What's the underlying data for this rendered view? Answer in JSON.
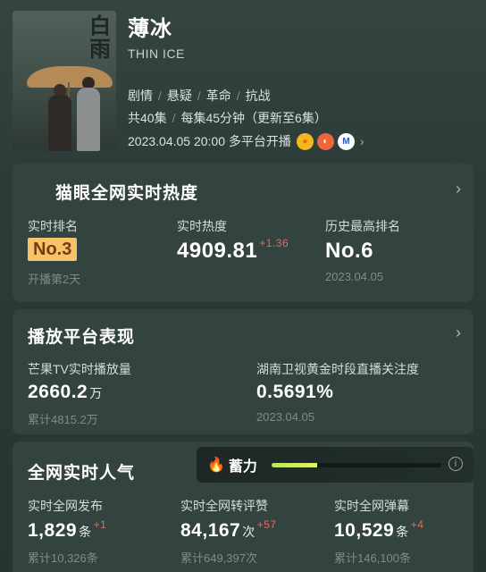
{
  "show": {
    "title": "薄冰",
    "subtitle": "THIN ICE",
    "poster_glyph": "白\n雨",
    "tags": [
      "剧情",
      "悬疑",
      "革命",
      "抗战"
    ],
    "episodes": "共40集",
    "duration": "每集45分钟（更新至6集）",
    "airing": "2023.04.05 20:00 多平台开播",
    "platform_icons": [
      "mango-tv-icon",
      "hunan-tv-icon",
      "m-platform-icon"
    ],
    "platform_glyphs": [
      "●",
      "◐",
      "M"
    ]
  },
  "heat": {
    "title": "猫眼全网实时热度",
    "rank_label": "实时排名",
    "rank_value": "No.3",
    "rank_sub": "开播第2天",
    "heat_label": "实时热度",
    "heat_value": "4909.81",
    "heat_delta": "+1.36",
    "best_label": "历史最高排名",
    "best_value": "No.6",
    "best_date": "2023.04.05"
  },
  "platform": {
    "title": "播放平台表现",
    "mango_label": "芒果TV实时播放量",
    "mango_value": "2660.2",
    "mango_unit": "万",
    "mango_total": "累计4815.2万",
    "hunan_label": "湖南卫视黄金时段直播关注度",
    "hunan_value": "0.5691%",
    "hunan_date": "2023.04.05"
  },
  "popularity": {
    "title": "全网实时人气",
    "post_label": "实时全网发布",
    "post_value": "1,829",
    "post_unit": "条",
    "post_delta": "+1",
    "post_total": "累计10,326条",
    "repost_label": "实时全网转评赞",
    "repost_value": "84,167",
    "repost_unit": "次",
    "repost_delta": "+57",
    "repost_total": "累计649,397次",
    "danmu_label": "实时全网弹幕",
    "danmu_value": "10,529",
    "danmu_unit": "条",
    "danmu_delta": "+4",
    "danmu_total": "累计146,100条"
  },
  "xuli": {
    "label": "蓄力",
    "progress_percent": 27,
    "info_glyph": "i"
  },
  "glyphs": {
    "chevron": "›",
    "separator": "/",
    "fire": "🔥"
  },
  "colors": {
    "accent_red": "#e9695d",
    "rank_badge": "#f5c469",
    "progress": "#d8ee62"
  }
}
